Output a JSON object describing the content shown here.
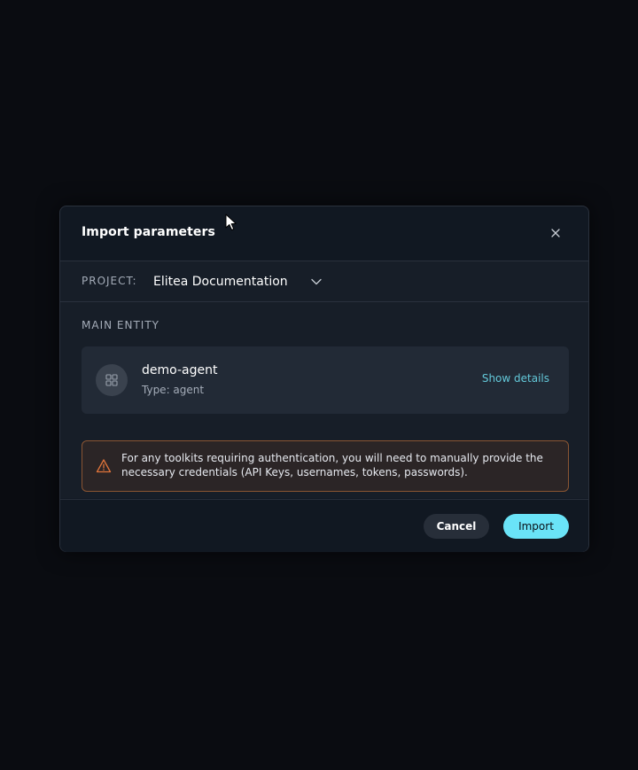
{
  "modal": {
    "title": "Import parameters"
  },
  "project": {
    "label": "PROJECT:",
    "selected": "Elitea Documentation"
  },
  "main_entity": {
    "section_label": "MAIN ENTITY",
    "name": "demo-agent",
    "type_text": "Type: agent",
    "show_details_label": "Show details"
  },
  "warning": {
    "text": "For any toolkits requiring authentication, you will need to manually provide the necessary credentials (API Keys, usernames, tokens, passwords)."
  },
  "footer": {
    "cancel_label": "Cancel",
    "import_label": "Import"
  },
  "icons": {
    "close": "close-icon",
    "dropdown": "chevron-down-icon",
    "entity": "grid-icon",
    "warning": "warning-triangle-icon",
    "cursor": "mouse-cursor-icon"
  },
  "colors": {
    "accent": "#6ae3f7",
    "link": "#63c8d9",
    "warning_border": "#8a5532",
    "warning_icon": "#e0743a"
  }
}
